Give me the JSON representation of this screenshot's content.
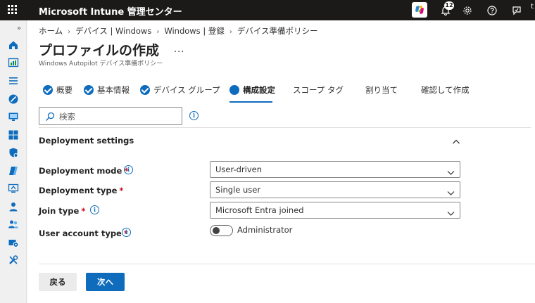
{
  "topbar": {
    "title": "Microsoft Intune 管理センター",
    "notification_count": "12",
    "user_initial": "t",
    "icons": [
      "waffle-icon",
      "copilot-icon",
      "notifications-icon",
      "settings-icon",
      "help-icon",
      "feedback-icon"
    ]
  },
  "leftnav": {
    "collapse": "»",
    "items": [
      "home-icon",
      "dashboard-icon",
      "all-services-icon",
      "devices-icon",
      "apps-icon",
      "endpoint-security-icon",
      "reports-icon",
      "users-icon",
      "groups-icon",
      "tenant-admin-icon",
      "troubleshooting-icon"
    ]
  },
  "breadcrumb": {
    "items": [
      "ホーム",
      "デバイス | Windows",
      "Windows | 登録",
      "デバイス準備ポリシー"
    ],
    "sep": "›"
  },
  "page": {
    "title": "プロファイルの作成",
    "more": "...",
    "subtitle": "Windows Autopilot デバイス準備ポリシー"
  },
  "steps": [
    {
      "label": "概要",
      "state": "done"
    },
    {
      "label": "基本情報",
      "state": "done"
    },
    {
      "label": "デバイス グループ",
      "state": "done"
    },
    {
      "label": "構成設定",
      "state": "active"
    },
    {
      "label": "スコープ タグ",
      "state": "pending"
    },
    {
      "label": "割り当て",
      "state": "pending"
    },
    {
      "label": "確認して作成",
      "state": "pending"
    }
  ],
  "search": {
    "placeholder": "検索"
  },
  "section": {
    "title": "Deployment settings"
  },
  "fields": {
    "deployment_mode": {
      "label": "Deployment mode",
      "required": "*",
      "value": "User-driven"
    },
    "deployment_type": {
      "label": "Deployment type",
      "required": "*",
      "value": "Single user"
    },
    "join_type": {
      "label": "Join type",
      "required": "*",
      "value": "Microsoft Entra joined"
    },
    "user_account_type": {
      "label": "User account type",
      "required": "*",
      "value": "Administrator",
      "toggle_on": false
    }
  },
  "buttons": {
    "back": "戻る",
    "next": "次へ"
  },
  "colors": {
    "accent": "#0f6cbd",
    "topbar": "#1b1a19",
    "required": "#c50f1f"
  }
}
